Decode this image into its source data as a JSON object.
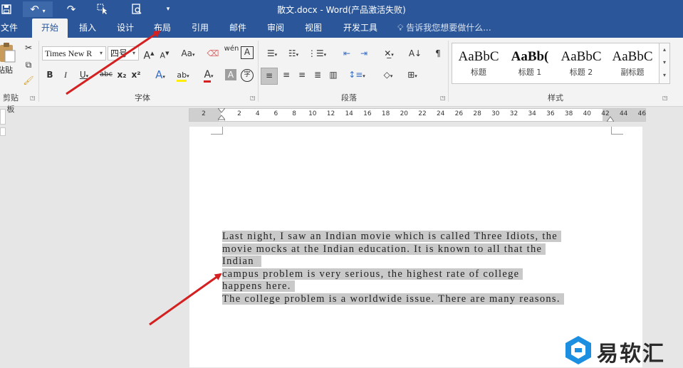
{
  "window": {
    "title": "散文.docx - Word(产品激活失败)"
  },
  "tabs": [
    {
      "label": "文件"
    },
    {
      "label": "开始"
    },
    {
      "label": "插入"
    },
    {
      "label": "设计"
    },
    {
      "label": "布局"
    },
    {
      "label": "引用"
    },
    {
      "label": "邮件"
    },
    {
      "label": "审阅"
    },
    {
      "label": "视图"
    },
    {
      "label": "开发工具"
    }
  ],
  "tell_me": {
    "text": "告诉我您想要做什么..."
  },
  "ribbon": {
    "clipboard": {
      "paste_label": "粘贴",
      "group_label": "剪贴板"
    },
    "font": {
      "font_name": "Times New R",
      "font_size": "四号",
      "group_label": "字体",
      "bold": "B",
      "italic": "I",
      "underline": "U",
      "strike": "abc",
      "sub": "x₂",
      "sup": "x²",
      "grow": "A",
      "shrink": "A",
      "case": "Aa",
      "pinyin": "wén",
      "border_a": "A",
      "effects_a": "A",
      "highlight_a": "ab",
      "color_a": "A",
      "shade_a": "A",
      "enclose": "字"
    },
    "paragraph": {
      "group_label": "段落"
    },
    "styles": {
      "group_label": "样式",
      "items": [
        {
          "preview": "AaBbC",
          "name": "标题"
        },
        {
          "preview": "AaBb(",
          "name": "标题 1"
        },
        {
          "preview": "AaBbC",
          "name": "标题 2"
        },
        {
          "preview": "AaBbC",
          "name": "副标题"
        }
      ]
    }
  },
  "ruler": {
    "ticks": [
      "2",
      "2",
      "4",
      "6",
      "8",
      "10",
      "12",
      "14",
      "16",
      "18",
      "20",
      "22",
      "24",
      "26",
      "28",
      "30",
      "32",
      "34",
      "36",
      "38",
      "40",
      "42",
      "44",
      "46"
    ]
  },
  "document": {
    "lines": [
      "Last night, I saw an Indian movie which is called Three Idiots, the ",
      "movie mocks at the Indian education. It is known to all that the ",
      "Indian  ",
      "campus problem is very serious, the highest rate of college ",
      "happens here. ",
      "The college problem is a worldwide issue. There are many reasons. "
    ]
  },
  "watermark": {
    "text": "易软汇"
  },
  "colors": {
    "title_bar": "#2b579a",
    "ribbon": "#f3f3f3",
    "selection": "#c9c9c9",
    "arrow": "#d42020"
  }
}
